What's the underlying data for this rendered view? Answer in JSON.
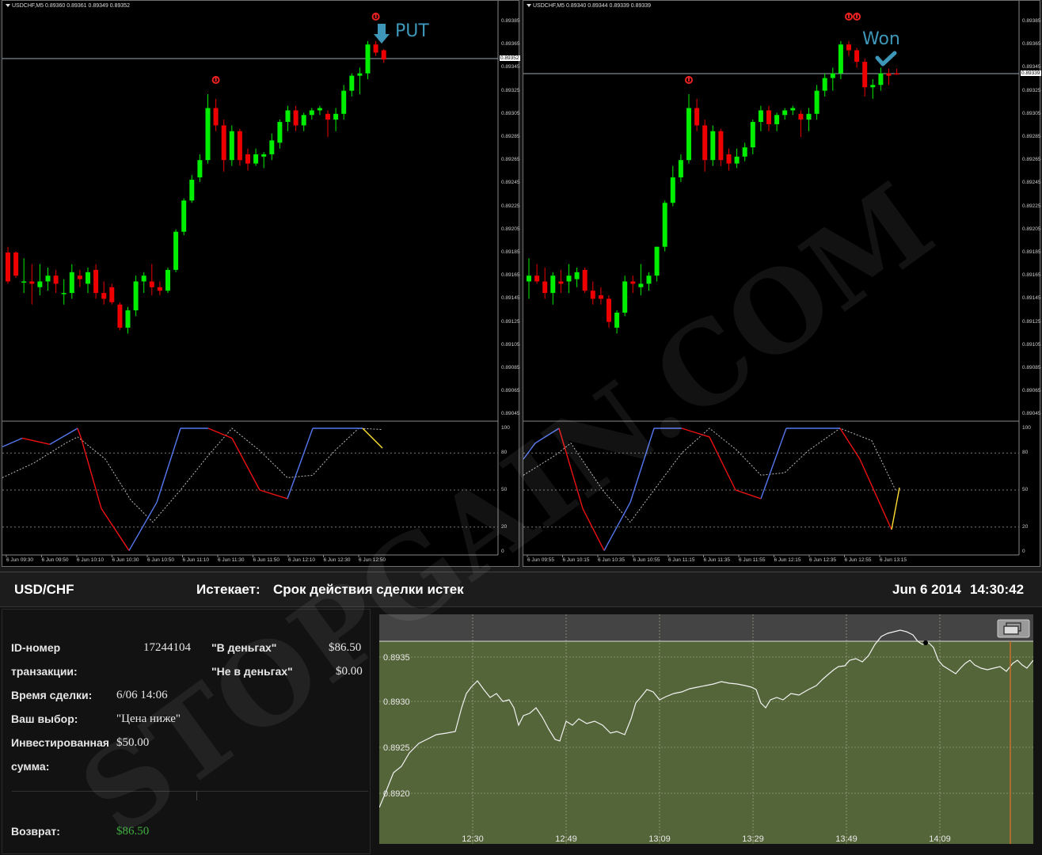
{
  "left_chart": {
    "title": "USDCHF,M5  0.89360 0.89361 0.89349 0.89352",
    "price_axis": [
      "0.89385",
      "0.89365",
      "0.89345",
      "0.89325",
      "0.89305",
      "0.89285",
      "0.89265",
      "0.89245",
      "0.89225",
      "0.89205",
      "0.89185",
      "0.89165",
      "0.89145",
      "0.89125",
      "0.89105",
      "0.89085",
      "0.89065",
      "0.89045"
    ],
    "current_price": "0.89352",
    "osc_axis": [
      "100",
      "80",
      "50",
      "20",
      "0"
    ],
    "time_axis": [
      "6 Jun 09:30",
      "6 Jun 09:50",
      "6 Jun 10:10",
      "6 Jun 10:30",
      "6 Jun 10:50",
      "6 Jun 11:10",
      "6 Jun 11:30",
      "6 Jun 11:50",
      "6 Jun 12:10",
      "6 Jun 12:30",
      "6 Jun 12:50"
    ],
    "signal_label": "PUT"
  },
  "right_chart": {
    "title": "USDCHF,M5  0.89340 0.89344 0.89339 0.89339",
    "price_axis": [
      "0.89385",
      "0.89365",
      "0.89345",
      "0.89325",
      "0.89305",
      "0.89285",
      "0.89265",
      "0.89245",
      "0.89225",
      "0.89205",
      "0.89185",
      "0.89165",
      "0.89145",
      "0.89125",
      "0.89105",
      "0.89085",
      "0.89065",
      "0.89045"
    ],
    "current_price": "0.89339",
    "osc_axis": [
      "100",
      "80",
      "50",
      "20",
      "0"
    ],
    "time_axis": [
      "6 Jun 09:55",
      "6 Jun 10:15",
      "6 Jun 10:35",
      "6 Jun 10:55",
      "6 Jun 11:15",
      "6 Jun 11:35",
      "6 Jun 11:55",
      "6 Jun 12:15",
      "6 Jun 12:35",
      "6 Jun 12:55",
      "6 Jun 13:15"
    ],
    "signal_label": "Won"
  },
  "watermark": "STOPGAIN.COM",
  "trade": {
    "symbol": "USD/CHF",
    "expires_label": "Истекает:",
    "expires_value": "Срок действия сделки истек",
    "date": "Jun 6 2014",
    "time": "14:30:42",
    "id_label_1": "ID-номер",
    "id_label_2": "транзакции:",
    "id_value": "17244104",
    "in_money_label": "\"В деньгах\"",
    "in_money_value": "$86.50",
    "out_money_label": "\"Не в деньгах\"",
    "out_money_value": "$0.00",
    "trade_time_label": "Время сделки:",
    "trade_time_value": "6/06 14:06",
    "choice_label": "Ваш выбор:",
    "choice_value": "\"Цена ниже\"",
    "invested_label_1": "Инвестированная",
    "invested_label_2": "сумма:",
    "invested_value": "$50.00",
    "return_label": "Возврат:",
    "return_value": "$86.50"
  },
  "mini_chart": {
    "y_labels": [
      "0.8935",
      "0.8930",
      "0.8925",
      "0.8920"
    ],
    "x_labels": [
      "12:30",
      "12:49",
      "13:09",
      "13:29",
      "13:49",
      "14:09"
    ]
  },
  "colors": {
    "bull": "#00ee00",
    "bear": "#ee0000",
    "osc_up": "#5577ee",
    "osc_down": "#ee1111",
    "osc_signal": "#ffdd33",
    "mini_bg": "#55653a",
    "mini_top": "#444444",
    "accent": "#3e97b8"
  }
}
